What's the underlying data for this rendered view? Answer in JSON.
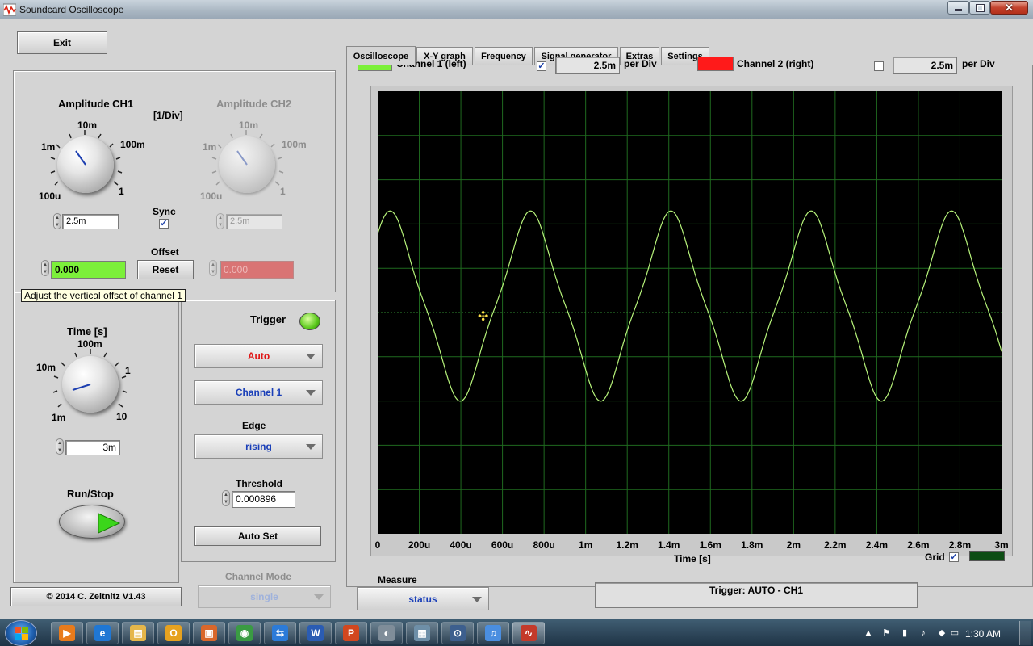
{
  "window": {
    "title": "Soundcard Oscilloscope"
  },
  "left": {
    "exit_label": "Exit",
    "amp_ch1": {
      "title": "Amplitude CH1",
      "ticks": [
        "10m",
        "1m",
        "100m",
        "100u",
        "1"
      ],
      "value": "2.5m"
    },
    "amp_ch2": {
      "title": "Amplitude CH2",
      "ticks": [
        "10m",
        "1m",
        "100m",
        "100u",
        "1"
      ],
      "value": "2.5m"
    },
    "unit_label": "[1/Div]",
    "sync_label": "Sync",
    "sync_checked": "✓",
    "offset_label": "Offset",
    "offset_ch1": "0.000",
    "offset_ch2": "0.000",
    "reset_label": "Reset",
    "tooltip": "Adjust the vertical offset of channel 1",
    "time": {
      "title": "Time [s]",
      "ticks": [
        "100m",
        "10m",
        "1",
        "1m",
        "10"
      ],
      "value": "3m"
    },
    "runstop_label": "Run/Stop",
    "copyright": "© 2014  C. Zeitnitz V1.43",
    "channel_mode_label": "Channel Mode",
    "channel_mode_value": "single"
  },
  "trigger": {
    "title": "Trigger",
    "mode": "Auto",
    "channel": "Channel 1",
    "edge_label": "Edge",
    "edge": "rising",
    "threshold_label": "Threshold",
    "threshold": "0.000896",
    "autoset_label": "Auto Set"
  },
  "tabs": [
    {
      "label": "Oscilloscope"
    },
    {
      "label": "X-Y graph"
    },
    {
      "label": "Frequency"
    },
    {
      "label": "Signal generator"
    },
    {
      "label": "Extras"
    },
    {
      "label": "Settings"
    }
  ],
  "scope": {
    "ch1_label": "Channel 1 (left)",
    "ch1_check": "✓",
    "ch1_div": "2.5m",
    "ch2_label": "Channel 2 (right)",
    "ch2_check": "",
    "ch2_div": "2.5m",
    "per_div": "per Div",
    "x_ticks": [
      "0",
      "200u",
      "400u",
      "600u",
      "800u",
      "1m",
      "1.2m",
      "1.4m",
      "1.6m",
      "1.8m",
      "2m",
      "2.2m",
      "2.4m",
      "2.6m",
      "2.8m",
      "3m"
    ],
    "x_axis_title": "Time [s]",
    "grid_label": "Grid",
    "grid_check": "✓",
    "measure_label": "Measure",
    "measure_value": "status",
    "status_text": "Trigger: AUTO - CH1"
  },
  "colors": {
    "ch1": "#7cf03a",
    "ch2": "#ff1a1a",
    "trace": "#b6f27a",
    "grid": "#1f6a1f",
    "screen": "#000000"
  },
  "taskbar": {
    "apps": [
      "media-player-icon",
      "ie-icon",
      "explorer-icon",
      "outlook-icon",
      "app-icon",
      "chrome-icon",
      "remote-icon",
      "word-icon",
      "powerpoint-icon",
      "viewer-icon",
      "calculator-icon",
      "lock-app-icon",
      "itunes-icon",
      "oscilloscope-app-icon"
    ],
    "clock": "1:30 AM"
  }
}
